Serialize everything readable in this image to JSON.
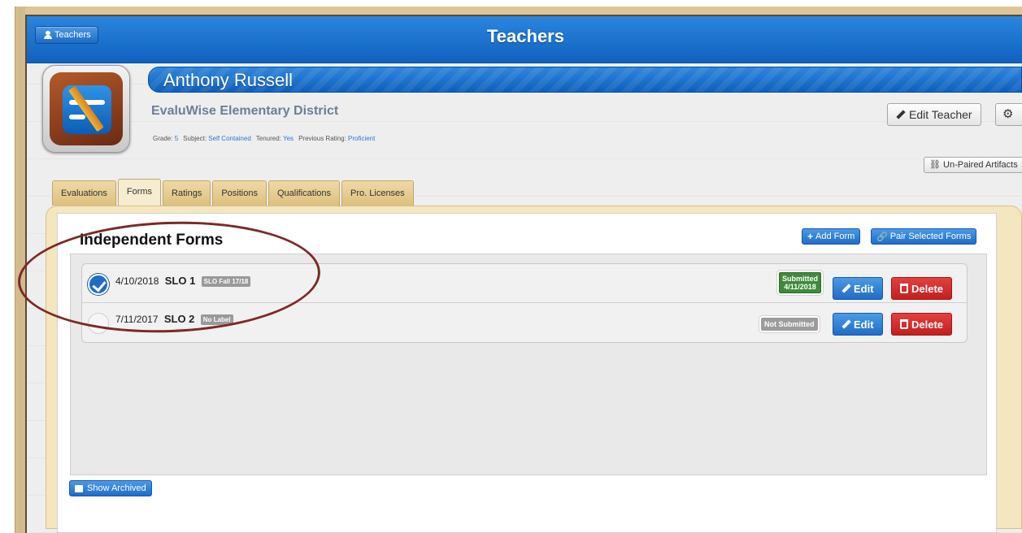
{
  "navbar": {
    "title": "Teachers",
    "back_label": "Teachers",
    "back_icon": "user-icon"
  },
  "teacher": {
    "name": "Anthony Russell",
    "district": "EvaluWise Elementary District",
    "meta": [
      {
        "label": "Grade:",
        "value": "5"
      },
      {
        "label": "Subject:",
        "value": "Self Contained"
      },
      {
        "label": "Tenured:",
        "value": "Yes"
      },
      {
        "label": "Previous Rating:",
        "value": "Proficient"
      }
    ]
  },
  "actions": {
    "edit_teacher": "Edit Teacher",
    "gear_icon": "⚙",
    "unpaired": "Un-Paired Artifacts"
  },
  "tabs": [
    {
      "label": "Evaluations",
      "active": false
    },
    {
      "label": "Forms",
      "active": true
    },
    {
      "label": "Ratings",
      "active": false
    },
    {
      "label": "Positions",
      "active": false
    },
    {
      "label": "Qualifications",
      "active": false
    },
    {
      "label": "Pro. Licenses",
      "active": false
    }
  ],
  "forms_panel": {
    "title": "Independent Forms",
    "add_form": "Add Form",
    "pair_forms": "Pair Selected Forms",
    "show_archived": "Show Archived",
    "rows": [
      {
        "date": "4/10/2018",
        "title": "SLO 1",
        "label": "SLO Fall 17/18",
        "status_line1": "Submitted",
        "status_line2": "4/11/2018",
        "edit": "Edit",
        "delete": "Delete",
        "checked": true
      },
      {
        "date": "7/11/2017",
        "title": "SLO 2",
        "label": "No Label",
        "status": "Not Submitted",
        "edit": "Edit",
        "delete": "Delete",
        "checked": false
      }
    ]
  },
  "colors": {
    "brand_blue": "#1f6dc7",
    "danger_red": "#c41f1f",
    "submitted_green": "#3f8a3b",
    "annotation": "#7b2a25"
  }
}
